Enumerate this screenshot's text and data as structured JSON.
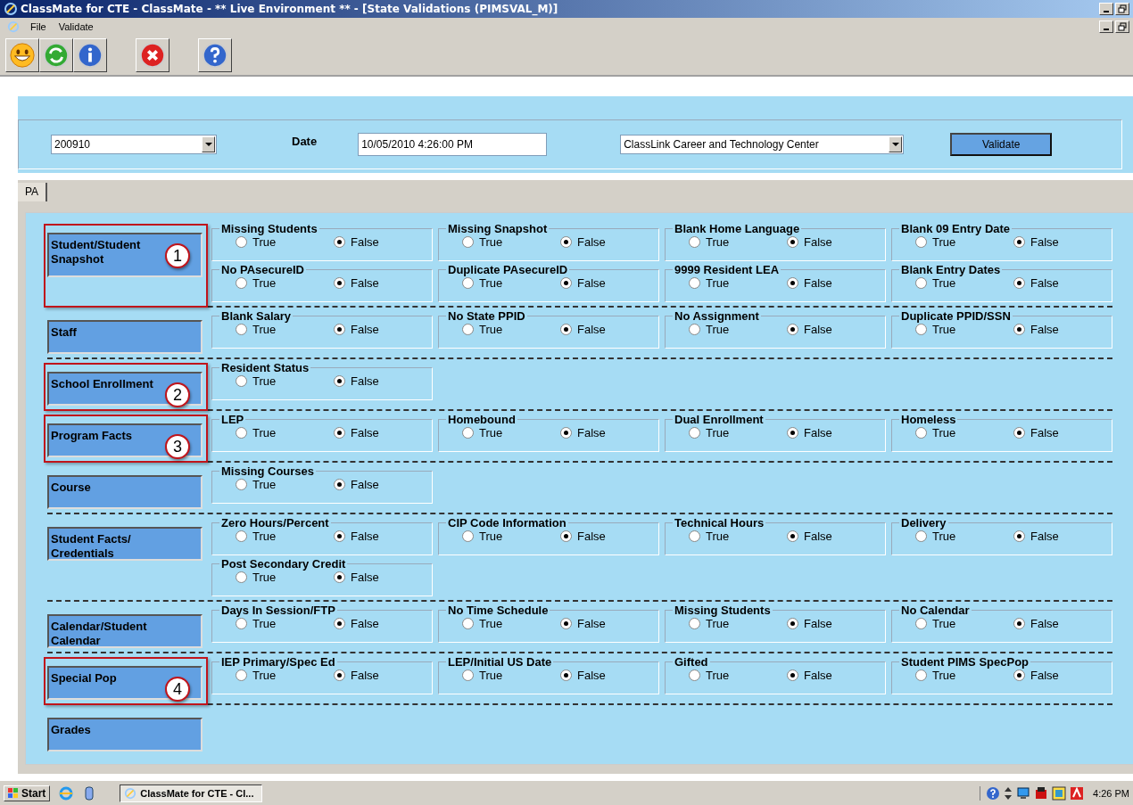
{
  "window": {
    "title": "ClassMate for CTE - ClassMate - ** Live Environment ** - [State Validations  (PIMSVAL_M)]"
  },
  "menu": [
    "File",
    "Validate"
  ],
  "header": {
    "period": "200910",
    "date_label": "Date",
    "date": "10/05/2010 4:26:00 PM",
    "school": "ClassLink Career and Technology Center",
    "validate_button": "Validate"
  },
  "tabs": [
    {
      "label": "PA",
      "selected": true
    }
  ],
  "sections": [
    {
      "label": "Student/Student Snapshot",
      "callout": "1",
      "rows": [
        [
          {
            "title": "Missing Students",
            "options": [
              {
                "label": "True",
                "selected": false
              },
              {
                "label": "False",
                "selected": true
              }
            ]
          },
          {
            "title": "Missing Snapshot",
            "options": [
              {
                "label": "True",
                "selected": false
              },
              {
                "label": "False",
                "selected": true
              }
            ]
          },
          {
            "title": "Blank Home Language",
            "options": [
              {
                "label": "True",
                "selected": false
              },
              {
                "label": "False",
                "selected": true
              }
            ]
          },
          {
            "title": "Blank 09 Entry Date",
            "options": [
              {
                "label": "True",
                "selected": false
              },
              {
                "label": "False",
                "selected": true
              }
            ]
          }
        ],
        [
          {
            "title": "No PAsecureID",
            "options": [
              {
                "label": "True",
                "selected": false
              },
              {
                "label": "False",
                "selected": true
              }
            ]
          },
          {
            "title": "Duplicate PAsecureID",
            "options": [
              {
                "label": "True",
                "selected": false
              },
              {
                "label": "False",
                "selected": true
              }
            ]
          },
          {
            "title": "9999 Resident LEA",
            "options": [
              {
                "label": "True",
                "selected": false
              },
              {
                "label": "False",
                "selected": true
              }
            ]
          },
          {
            "title": "Blank Entry Dates",
            "options": [
              {
                "label": "True",
                "selected": false
              },
              {
                "label": "False",
                "selected": true
              }
            ]
          }
        ]
      ]
    },
    {
      "label": "Staff",
      "rows": [
        [
          {
            "title": "Blank Salary",
            "options": [
              {
                "label": "True",
                "selected": false
              },
              {
                "label": "False",
                "selected": true
              }
            ]
          },
          {
            "title": "No State PPID",
            "options": [
              {
                "label": "True",
                "selected": false
              },
              {
                "label": "False",
                "selected": true
              }
            ]
          },
          {
            "title": "No Assignment",
            "options": [
              {
                "label": "True",
                "selected": false
              },
              {
                "label": "False",
                "selected": true
              }
            ]
          },
          {
            "title": "Duplicate PPID/SSN",
            "options": [
              {
                "label": "True",
                "selected": false
              },
              {
                "label": "False",
                "selected": true
              }
            ]
          }
        ]
      ]
    },
    {
      "label": "School Enrollment",
      "callout": "2",
      "rows": [
        [
          {
            "title": "Resident Status",
            "options": [
              {
                "label": "True",
                "selected": false
              },
              {
                "label": "False",
                "selected": true
              }
            ]
          }
        ]
      ]
    },
    {
      "label": "Program Facts",
      "callout": "3",
      "rows": [
        [
          {
            "title": "LEP",
            "options": [
              {
                "label": "True",
                "selected": false
              },
              {
                "label": "False",
                "selected": true
              }
            ]
          },
          {
            "title": "Homebound",
            "options": [
              {
                "label": "True",
                "selected": false
              },
              {
                "label": "False",
                "selected": true
              }
            ]
          },
          {
            "title": "Dual Enrollment",
            "options": [
              {
                "label": "True",
                "selected": false
              },
              {
                "label": "False",
                "selected": true
              }
            ]
          },
          {
            "title": "Homeless",
            "options": [
              {
                "label": "True",
                "selected": false
              },
              {
                "label": "False",
                "selected": true
              }
            ]
          }
        ]
      ]
    },
    {
      "label": "Course",
      "rows": [
        [
          {
            "title": "Missing Courses",
            "options": [
              {
                "label": "True",
                "selected": false
              },
              {
                "label": "False",
                "selected": true
              }
            ]
          }
        ]
      ]
    },
    {
      "label": "Student Facts/ Credentials",
      "rows": [
        [
          {
            "title": "Zero Hours/Percent",
            "options": [
              {
                "label": "True",
                "selected": false
              },
              {
                "label": "False",
                "selected": true
              }
            ]
          },
          {
            "title": "CIP Code Information",
            "options": [
              {
                "label": "True",
                "selected": false
              },
              {
                "label": "False",
                "selected": true
              }
            ]
          },
          {
            "title": "Technical Hours",
            "options": [
              {
                "label": "True",
                "selected": false
              },
              {
                "label": "False",
                "selected": true
              }
            ]
          },
          {
            "title": "Delivery",
            "options": [
              {
                "label": "True",
                "selected": false
              },
              {
                "label": "False",
                "selected": true
              }
            ]
          }
        ],
        [
          {
            "title": "Post Secondary Credit",
            "options": [
              {
                "label": "True",
                "selected": false
              },
              {
                "label": "False",
                "selected": true
              }
            ]
          }
        ]
      ]
    },
    {
      "label": "Calendar/Student Calendar",
      "rows": [
        [
          {
            "title": "Days In Session/FTP",
            "options": [
              {
                "label": "True",
                "selected": false
              },
              {
                "label": "False",
                "selected": true
              }
            ]
          },
          {
            "title": "No Time Schedule",
            "options": [
              {
                "label": "True",
                "selected": false
              },
              {
                "label": "False",
                "selected": true
              }
            ]
          },
          {
            "title": "Missing Students",
            "options": [
              {
                "label": "True",
                "selected": false
              },
              {
                "label": "False",
                "selected": true
              }
            ]
          },
          {
            "title": "No Calendar",
            "options": [
              {
                "label": "True",
                "selected": false
              },
              {
                "label": "False",
                "selected": true
              }
            ]
          }
        ]
      ]
    },
    {
      "label": "Special Pop",
      "callout": "4",
      "rows": [
        [
          {
            "title": "IEP Primary/Spec Ed",
            "options": [
              {
                "label": "True",
                "selected": false
              },
              {
                "label": "False",
                "selected": true
              }
            ]
          },
          {
            "title": "LEP/Initial US Date",
            "options": [
              {
                "label": "True",
                "selected": false
              },
              {
                "label": "False",
                "selected": true
              }
            ]
          },
          {
            "title": "Gifted",
            "options": [
              {
                "label": "True",
                "selected": false
              },
              {
                "label": "False",
                "selected": true
              }
            ]
          },
          {
            "title": "Student PIMS SpecPop",
            "options": [
              {
                "label": "True",
                "selected": false
              },
              {
                "label": "False",
                "selected": true
              }
            ]
          }
        ]
      ]
    },
    {
      "label": "Grades"
    }
  ],
  "taskbar": {
    "start": "Start",
    "task": "ClassMate for CTE - Cl...",
    "clock": "4:26 PM"
  }
}
